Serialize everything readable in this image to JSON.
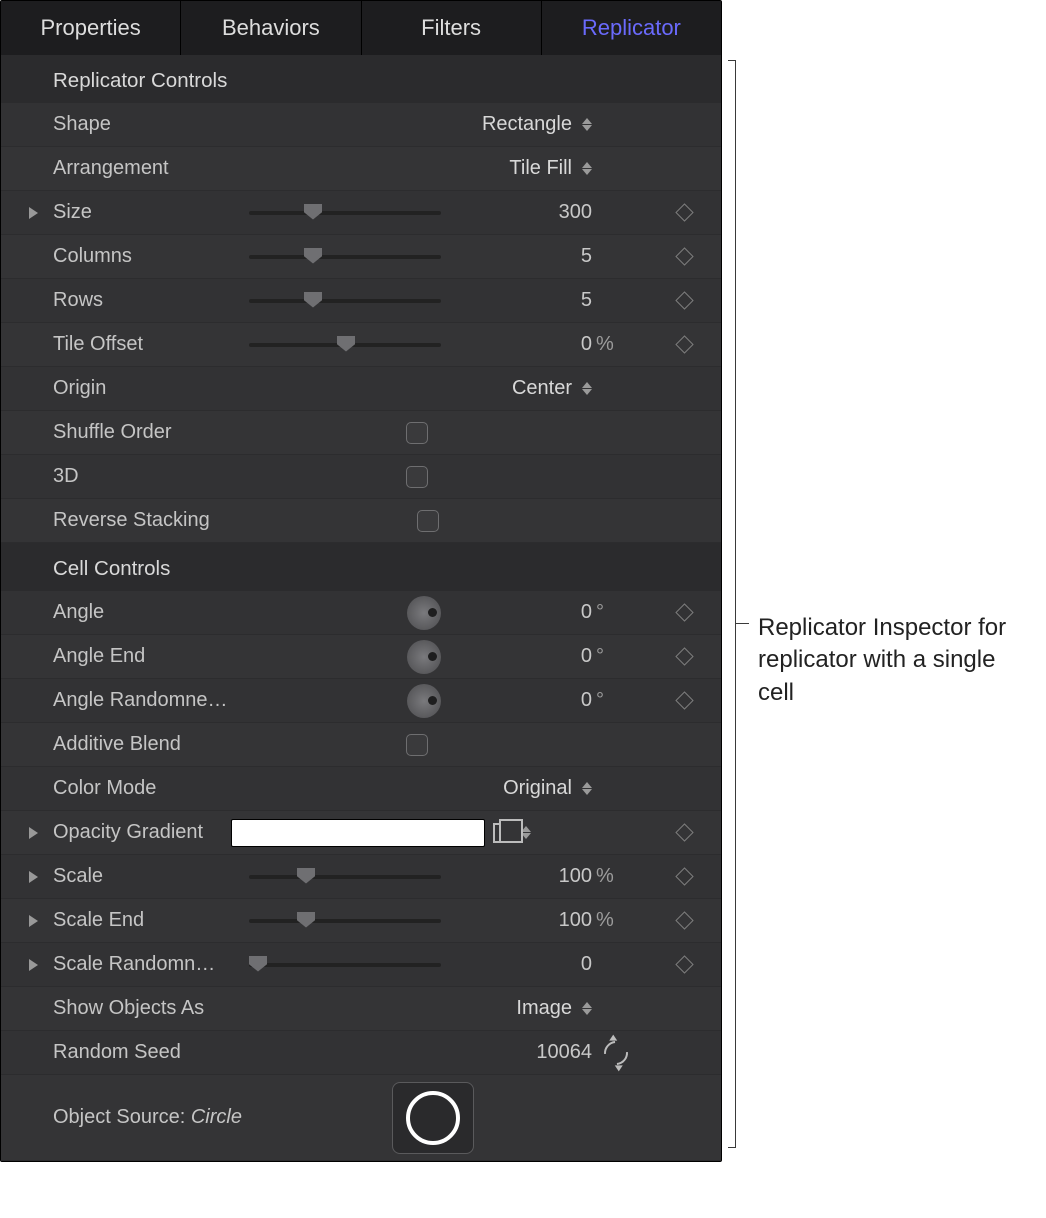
{
  "tabs": {
    "properties": "Properties",
    "behaviors": "Behaviors",
    "filters": "Filters",
    "replicator": "Replicator"
  },
  "section1": {
    "title": "Replicator Controls"
  },
  "shape": {
    "label": "Shape",
    "value": "Rectangle"
  },
  "arrangement": {
    "label": "Arrangement",
    "value": "Tile Fill"
  },
  "size": {
    "label": "Size",
    "value": "300"
  },
  "columns": {
    "label": "Columns",
    "value": "5"
  },
  "rows": {
    "label": "Rows",
    "value": "5"
  },
  "tile_offset": {
    "label": "Tile Offset",
    "value": "0",
    "unit": "%"
  },
  "origin": {
    "label": "Origin",
    "value": "Center"
  },
  "shuffle": {
    "label": "Shuffle Order"
  },
  "threeD": {
    "label": "3D"
  },
  "reverse": {
    "label": "Reverse Stacking"
  },
  "section2": {
    "title": "Cell Controls"
  },
  "angle": {
    "label": "Angle",
    "value": "0",
    "unit": "°"
  },
  "angle_end": {
    "label": "Angle End",
    "value": "0",
    "unit": "°"
  },
  "angle_rand": {
    "label": "Angle Randomne…",
    "value": "0",
    "unit": "°"
  },
  "additive": {
    "label": "Additive Blend"
  },
  "color_mode": {
    "label": "Color Mode",
    "value": "Original"
  },
  "opacity_grad": {
    "label": "Opacity Gradient"
  },
  "scale": {
    "label": "Scale",
    "value": "100",
    "unit": "%"
  },
  "scale_end": {
    "label": "Scale End",
    "value": "100",
    "unit": "%"
  },
  "scale_rand": {
    "label": "Scale Randomn…",
    "value": "0"
  },
  "show_as": {
    "label": "Show Objects As",
    "value": "Image"
  },
  "random_seed": {
    "label": "Random Seed",
    "value": "10064"
  },
  "obj_source": {
    "label": "Object Source: ",
    "name": "Circle"
  },
  "callout": "Replicator Inspector for replicator with a single cell"
}
